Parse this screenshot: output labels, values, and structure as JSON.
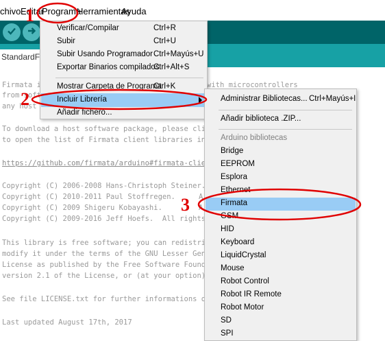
{
  "menubar": {
    "items": [
      {
        "label": "chivo"
      },
      {
        "label": "Editar"
      },
      {
        "label": "Programa"
      },
      {
        "label": "Herramientas"
      },
      {
        "label": "Ayuda"
      }
    ]
  },
  "toolbar": {
    "buttons": [
      {
        "icon": "checkmark-icon"
      },
      {
        "icon": "arrow-right-icon"
      },
      {
        "icon": "new-file-icon"
      }
    ]
  },
  "tabs": {
    "active_label": "StandardFirmata"
  },
  "editor": {
    "lines": [
      "Firmata i",
      "from soft",
      "any host",
      "To download a host software package, please clic",
      "to open the list of Firmata client libraries in",
      "https://github.com/firmata/arduino#firmata-clie",
      "Copyright (C) 2006-2008 Hans-Christoph Steiner.",
      "Copyright (C) 2010-2011 Paul Stoffregen.",
      "Copyright (C) 2009 Shigeru Kobayashi.",
      "Copyright (C) 2009-2016 Jeff Hoefs.  All rights",
      "This library is free software; you can redistrib",
      "modify it under the terms of the GNU Lesser Gene",
      "License as published by the Free Software Founde",
      "version 2.1 of the License, or (at your option)",
      "See file LICENSE.txt for further informations on",
      "Last updated August 17th, 2017"
    ],
    "line1_tail": "with microcontrollers",
    "copyright1_tail": "A",
    "copyright2_tail": "A"
  },
  "menu_programa": {
    "items": [
      {
        "label": "Verificar/Compilar",
        "shortcut": "Ctrl+R"
      },
      {
        "label": "Subir",
        "shortcut": "Ctrl+U"
      },
      {
        "label": "Subir Usando Programador",
        "shortcut": "Ctrl+Mayús+U"
      },
      {
        "label": "Exportar Binarios compilados",
        "shortcut": "Ctrl+Alt+S"
      },
      {
        "label": "Mostrar Carpeta de Programa",
        "shortcut": "Ctrl+K"
      },
      {
        "label": "Incluir Librería",
        "shortcut": ""
      },
      {
        "label": "Añadir fichero...",
        "shortcut": ""
      }
    ]
  },
  "menu_libreria": {
    "manage": {
      "label": "Administrar Bibliotecas...",
      "shortcut": "Ctrl+Mayús+I"
    },
    "add_zip": {
      "label": "Añadir biblioteca .ZIP..."
    },
    "section_header": "Arduino bibliotecas",
    "libraries": [
      "Bridge",
      "EEPROM",
      "Esplora",
      "Ethernet",
      "Firmata",
      "GSM",
      "HID",
      "Keyboard",
      "LiquidCrystal",
      "Mouse",
      "Robot Control",
      "Robot IR Remote",
      "Robot Motor",
      "SD",
      "SPI"
    ]
  },
  "annotations": {
    "step1": "1",
    "step2": "2",
    "step3": "3",
    "color": "#e00000"
  },
  "colors": {
    "toolbar_bg": "#006468",
    "tabstrip_bg": "#17a1a5",
    "button_bg": "#4db7bb",
    "menu_bg": "#f0f0f0",
    "highlight": "#99ccf5"
  }
}
